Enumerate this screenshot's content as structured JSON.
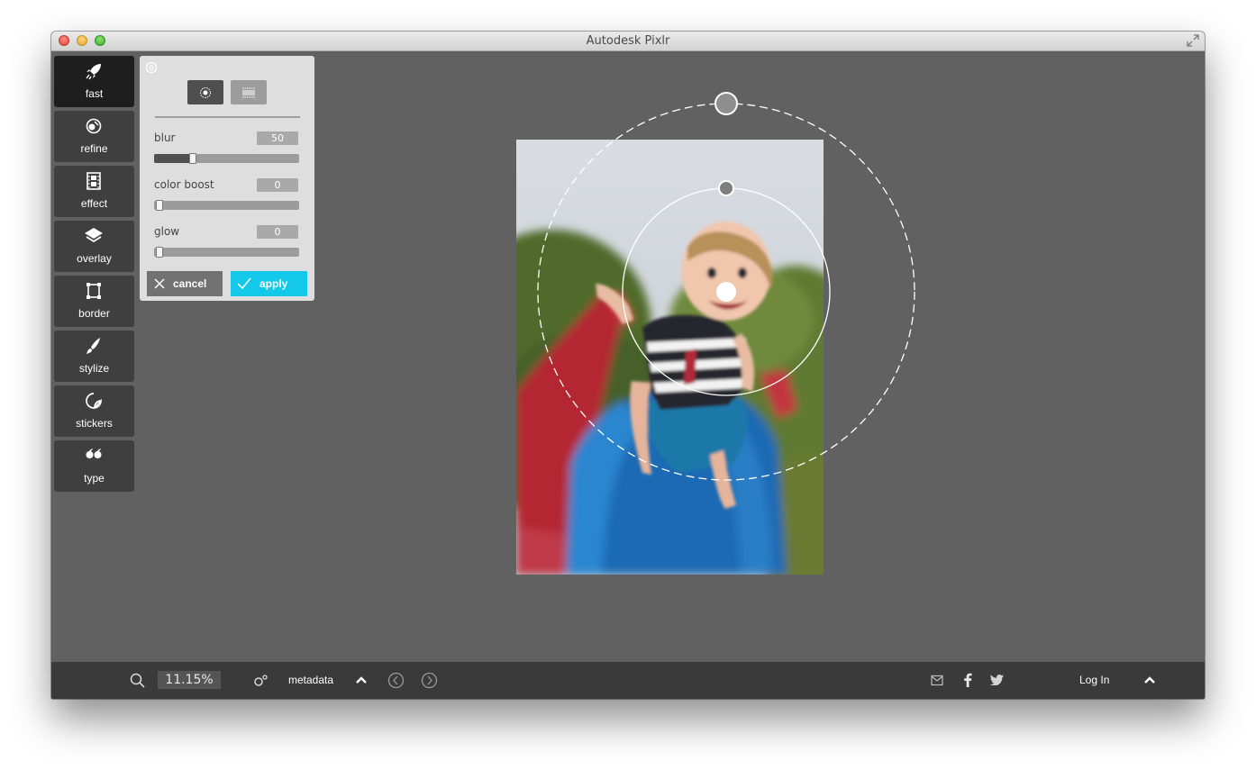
{
  "window": {
    "title": "Autodesk Pixlr"
  },
  "tools": [
    {
      "label": "fast",
      "icon": "rocket-icon",
      "active": true
    },
    {
      "label": "refine",
      "icon": "refine-icon"
    },
    {
      "label": "effect",
      "icon": "film-icon"
    },
    {
      "label": "overlay",
      "icon": "layers-icon"
    },
    {
      "label": "border",
      "icon": "border-icon"
    },
    {
      "label": "stylize",
      "icon": "brush-icon"
    },
    {
      "label": "stickers",
      "icon": "sticker-icon"
    },
    {
      "label": "type",
      "icon": "quote-icon"
    }
  ],
  "panel": {
    "mode": "radial",
    "sliders": [
      {
        "label": "blur",
        "value": "50",
        "fraction": 0.25
      },
      {
        "label": "color boost",
        "value": "0",
        "fraction": 0
      },
      {
        "label": "glow",
        "value": "0",
        "fraction": 0
      }
    ],
    "cancel_label": "cancel",
    "apply_label": "apply"
  },
  "colors": {
    "accent": "#14c8ea",
    "background": "#616161",
    "toolbar": "#3a3a3a"
  },
  "bottom": {
    "zoom": "11.15%",
    "metadata_label": "metadata",
    "login_label": "Log In"
  }
}
